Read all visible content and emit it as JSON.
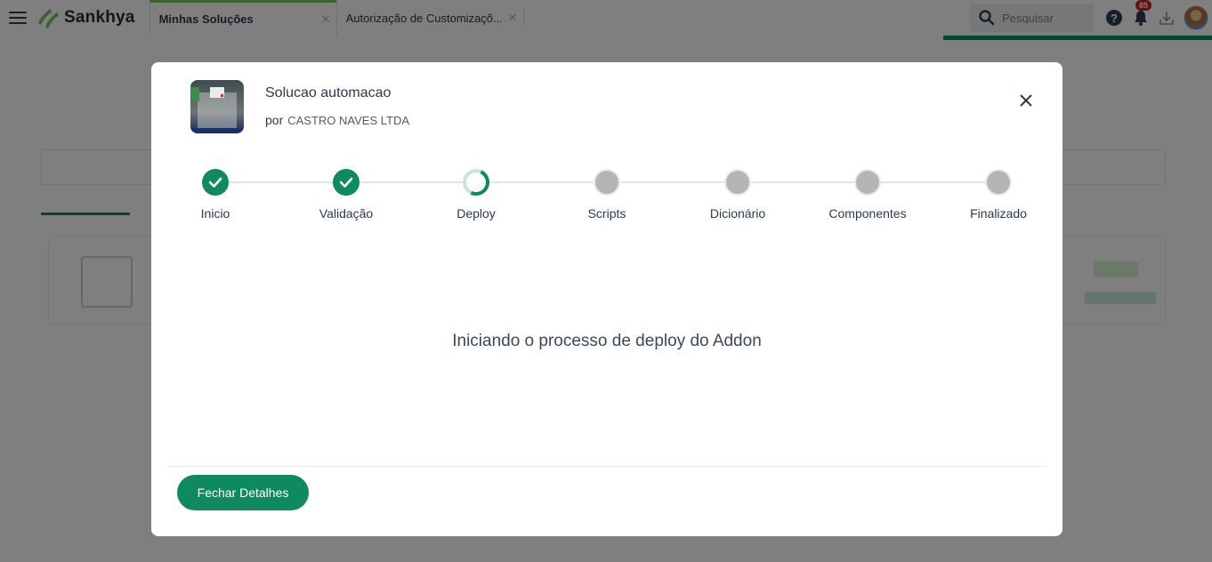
{
  "topbar": {
    "brand": "Sankhya",
    "tabs": [
      {
        "label": "Minhas Soluções",
        "active": true
      },
      {
        "label": "Autorização de Customizaçõ...",
        "active": false
      }
    ],
    "search_placeholder": "Pesquisar",
    "notification_count": "85",
    "icons": [
      "menu-icon",
      "sankhya-logo",
      "close-icon",
      "search-icon",
      "help-icon",
      "bell-icon",
      "download-icon",
      "avatar"
    ]
  },
  "modal": {
    "solution_title": "Solucao automacao",
    "by_label": "por",
    "company": "CASTRO NAVES LTDA",
    "steps": [
      {
        "label": "Inicio",
        "status": "done"
      },
      {
        "label": "Validação",
        "status": "done"
      },
      {
        "label": "Deploy",
        "status": "active"
      },
      {
        "label": "Scripts",
        "status": "pending"
      },
      {
        "label": "Dicionário",
        "status": "pending"
      },
      {
        "label": "Componentes",
        "status": "pending"
      },
      {
        "label": "Finalizado",
        "status": "pending"
      }
    ],
    "message": "Iniciando o processo de deploy do Addon",
    "close_button": "Fechar Detalhes"
  },
  "colors": {
    "accent": "#0f8a5f",
    "tab_active_border": "#79c35b",
    "badge": "#d91b1b",
    "pending_step": "#b5b5b5"
  }
}
